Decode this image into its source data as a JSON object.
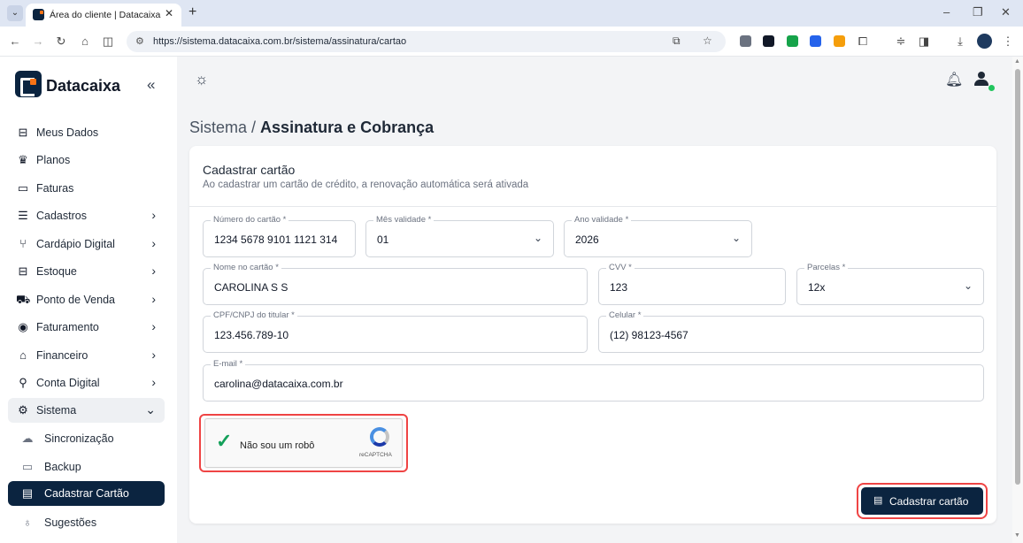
{
  "browser": {
    "tab_title": "Área do cliente | Datacaixa",
    "url": "https://sistema.datacaixa.com.br/sistema/assinatura/cartao"
  },
  "sidebar": {
    "brand": "Datacaixa",
    "items": [
      {
        "label": "Meus Dados",
        "icon": "id-card-icon"
      },
      {
        "label": "Planos",
        "icon": "crown-icon"
      },
      {
        "label": "Faturas",
        "icon": "invoice-icon"
      },
      {
        "label": "Cadastros",
        "icon": "list-icon"
      },
      {
        "label": "Cardápio Digital",
        "icon": "cutlery-icon"
      },
      {
        "label": "Estoque",
        "icon": "box-icon"
      },
      {
        "label": "Ponto de Venda",
        "icon": "cart-icon"
      },
      {
        "label": "Faturamento",
        "icon": "coin-icon"
      },
      {
        "label": "Financeiro",
        "icon": "bank-icon"
      },
      {
        "label": "Conta Digital",
        "icon": "nodes-icon"
      },
      {
        "label": "Sistema",
        "icon": "gear-icon"
      },
      {
        "label": "Sincronização",
        "icon": "cloud-upload-icon"
      },
      {
        "label": "Backup",
        "icon": "drive-icon"
      },
      {
        "label": "Cadastrar Cartão",
        "icon": "credit-card-icon"
      },
      {
        "label": "Sugestões",
        "icon": "lightbulb-icon"
      }
    ]
  },
  "breadcrumb": {
    "section": "Sistema /",
    "page": "Assinatura e Cobrança"
  },
  "card": {
    "title": "Cadastrar cartão",
    "subtitle": "Ao cadastrar um cartão de crédito, a renovação automática será ativada"
  },
  "form": {
    "card_number": {
      "label": "Número do cartão *",
      "value": "1234 5678 9101 1121 314"
    },
    "month": {
      "label": "Mês validade *",
      "value": "01"
    },
    "year": {
      "label": "Ano validade *",
      "value": "2026"
    },
    "name": {
      "label": "Nome no cartão *",
      "value": "CAROLINA S S"
    },
    "cvv": {
      "label": "CVV *",
      "value": "123"
    },
    "installments": {
      "label": "Parcelas *",
      "value": "12x"
    },
    "document": {
      "label": "CPF/CNPJ do titular *",
      "value": "123.456.789-10"
    },
    "phone": {
      "label": "Celular *",
      "value": "(12) 98123-4567"
    },
    "email": {
      "label": "E-mail *",
      "value": "carolina@datacaixa.com.br"
    }
  },
  "captcha": {
    "text": "Não sou um robô",
    "brand": "reCAPTCHA"
  },
  "submit_label": "Cadastrar cartão",
  "colors": {
    "primary": "#0b2440",
    "accent": "#f97316",
    "highlight": "#ef4444",
    "check": "#14a05a"
  }
}
